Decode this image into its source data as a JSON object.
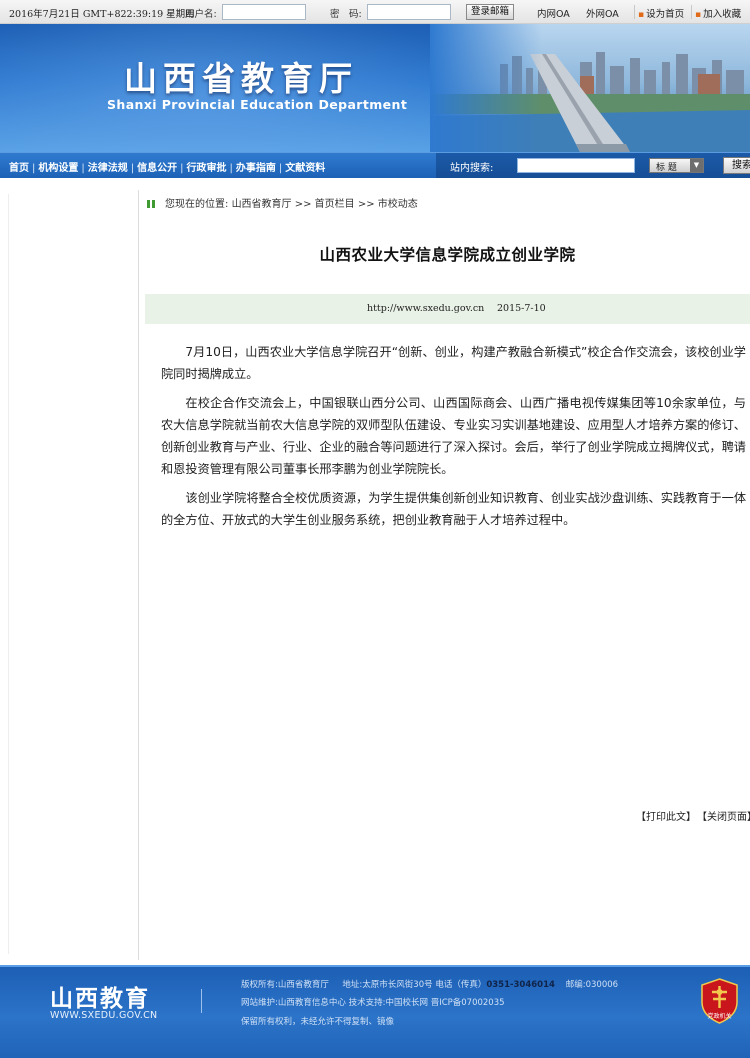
{
  "topbar": {
    "datetime": "2016年7月21日 GMT+822:39:19 星期四",
    "username_label": "用户名:",
    "username_value": "",
    "password_label": "密　码:",
    "password_value": "",
    "login_button": "登录邮箱",
    "links": [
      "内网OA",
      "外网OA"
    ],
    "set_homepage": "设为首页",
    "add_favorite": "加入收藏"
  },
  "banner": {
    "title": "山西省教育厅",
    "subtitle": "Shanxi Provincial Education Department"
  },
  "nav": {
    "items": [
      "首页",
      "机构设置",
      "法律法规",
      "信息公开",
      "行政审批",
      "办事指南",
      "文献资料"
    ],
    "search_label": "站内搜索:",
    "search_value": "",
    "search_field_option": "标 题",
    "search_button": "搜索"
  },
  "breadcrumb": {
    "prefix": "您现在的位置:",
    "path": "山西省教育厅 >> 首页栏目 >> 市校动态"
  },
  "article": {
    "title": "山西农业大学信息学院成立创业学院",
    "source_url": "http://www.sxedu.gov.cn",
    "date": "2015-7-10",
    "paragraphs": [
      "7月10日，山西农业大学信息学院召开“创新、创业，构建产教融合新模式”校企合作交流会，该校创业学院同时揭牌成立。",
      "在校企合作交流会上，中国银联山西分公司、山西国际商会、山西广播电视传媒集团等10余家单位，与农大信息学院就当前农大信息学院的双师型队伍建设、专业实习实训基地建设、应用型人才培养方案的修订、创新创业教育与产业、行业、企业的融合等问题进行了深入探讨。会后，举行了创业学院成立揭牌仪式，聘请和恩投资管理有限公司董事长邢李鹏为创业学院院长。",
      "该创业学院将整合全校优质资源，为学生提供集创新创业知识教育、创业实战沙盘训练、实践教育于一体的全方位、开放式的大学生创业服务系统，把创业教育融于人才培养过程中。"
    ],
    "print_link": "【打印此文】",
    "close_link": "【关闭页面】"
  },
  "footer": {
    "logo_text": "山西教育",
    "logo_site": "WWW.SXEDU.GOV.CN",
    "copyright_label": "版权所有:",
    "copyright_value": "山西省教育厅",
    "address_label": "地址:",
    "address_value": "太原市长风街30号",
    "phone_label": "电话（传真）",
    "phone_value": "0351-3046014",
    "postcode_label": "邮编:",
    "postcode_value": "030006",
    "maintain_label": "网站维护:",
    "maintain_value": "山西教育信息中心",
    "tech_label": "技术支持:",
    "tech_value": "中国校长网",
    "icp": "晋ICP备07002035",
    "rights": "保留所有权利，未经允许不得复制、镜像",
    "emblem_text": "党政机关"
  },
  "colors": {
    "banner_blue": "#1d5fb4",
    "nav_blue": "#2f7bd0",
    "meta_band": "#e9f2e6",
    "accent_orange": "#e06a18"
  }
}
